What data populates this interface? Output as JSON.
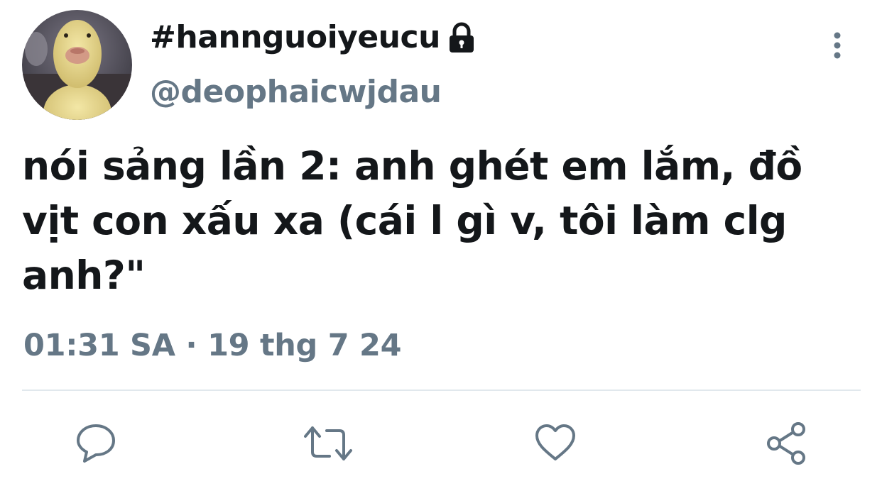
{
  "tweet": {
    "display_name": "#hannguoiyeucu",
    "handle": "@deophaicwjdau",
    "text": "nói sảng lần 2: anh ghét em lắm, đồ vịt con xấu xa (cái l gì v, tôi làm clg anh?\"",
    "timestamp": "01:31 SA · 19 thg 7 24",
    "protected": true,
    "avatar": "duckling-photo"
  },
  "actions": [
    {
      "name": "reply",
      "icon": "speech-bubble-icon"
    },
    {
      "name": "retweet",
      "icon": "retweet-arrows-icon"
    },
    {
      "name": "like",
      "icon": "heart-icon"
    },
    {
      "name": "share",
      "icon": "share-nodes-icon"
    }
  ],
  "colors": {
    "primary_text": "#14171a",
    "secondary_text": "#657786",
    "icon": "#657786",
    "divider": "#e1e8ed"
  }
}
